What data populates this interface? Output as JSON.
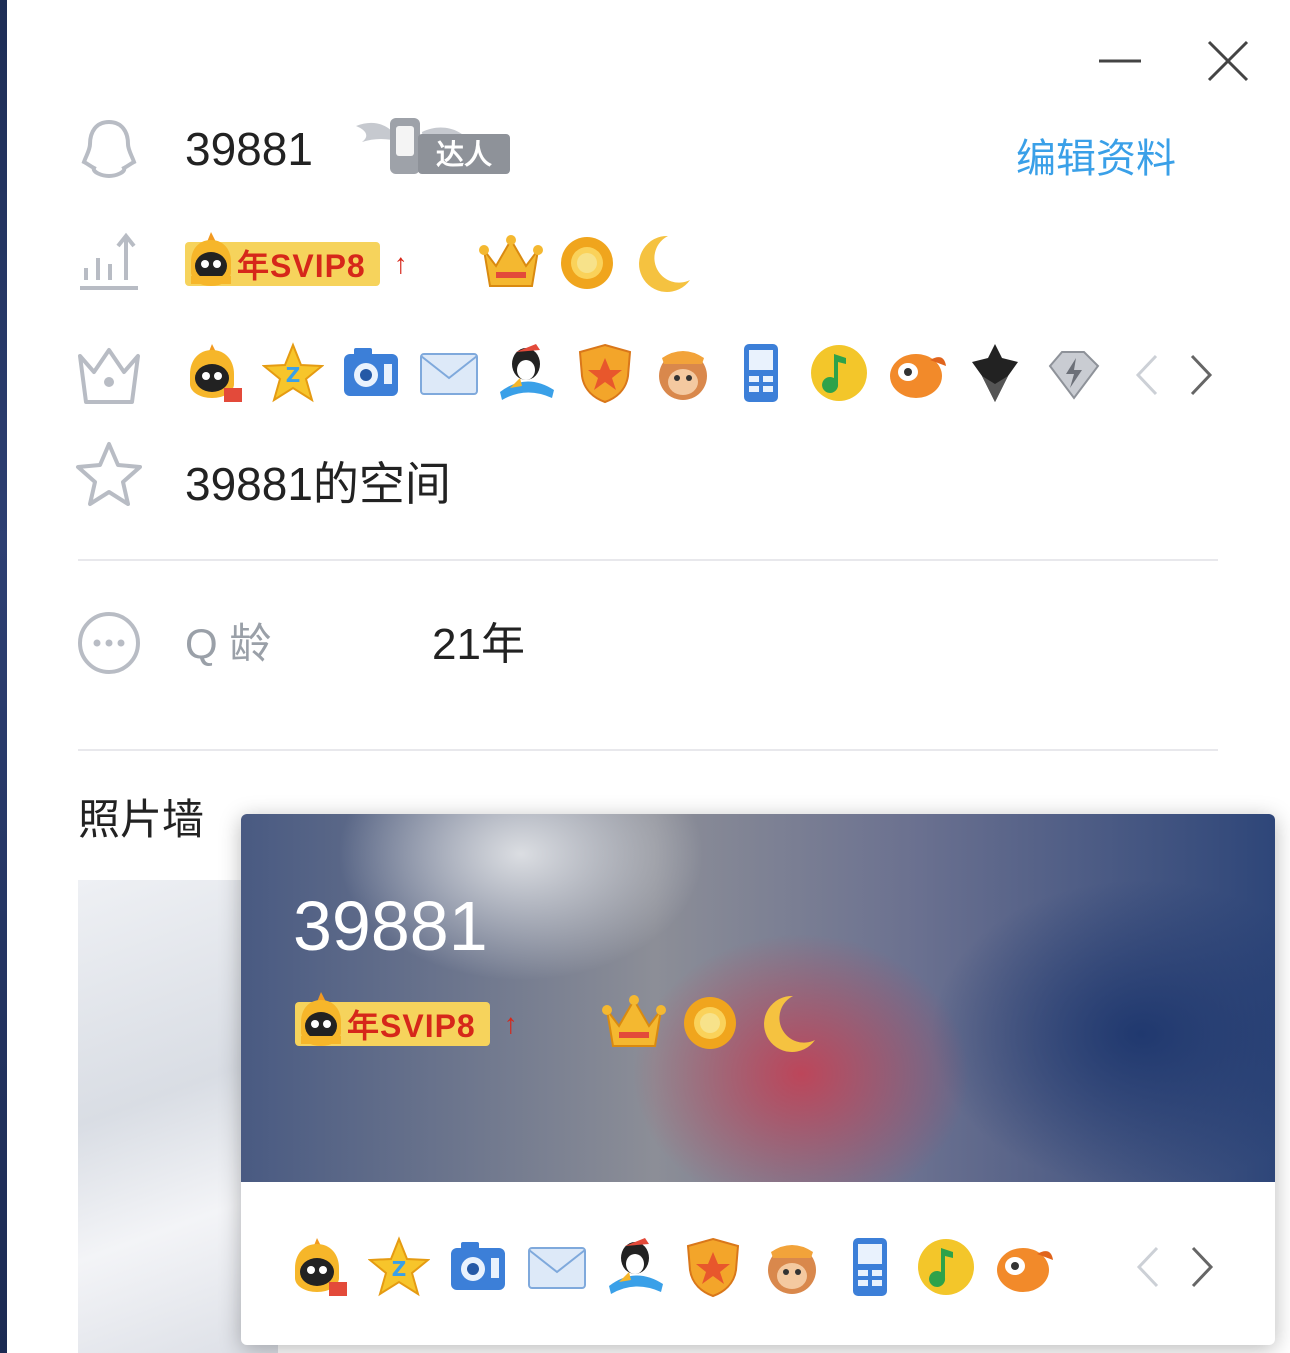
{
  "window": {
    "minimize_label": "minimize",
    "close_label": "close"
  },
  "profile": {
    "qq_number": "39881",
    "edit_label": "编辑资料",
    "vip_badge": "年SVIP8",
    "space_label": "39881的空间",
    "qage_label": "Q 龄",
    "qage_value": "21年"
  },
  "photo_wall": {
    "title": "照片墙"
  },
  "card": {
    "name": "39881",
    "vip_badge": "年SVIP8"
  },
  "icons": {
    "rows": [
      "qq-penguin-outline-icon",
      "level-chart-icon",
      "crown-outline-icon",
      "star-outline-icon",
      "more-circle-icon"
    ],
    "levels": [
      "crown-icon",
      "sun-icon",
      "moon-icon"
    ],
    "services": [
      "vip-penguin-icon",
      "qzone-star-icon",
      "camera-icon",
      "mail-icon",
      "qq-penguin-ski-icon",
      "shield-icon",
      "monkey-icon",
      "phone-icon",
      "music-icon",
      "fish-icon",
      "diamond-dark-icon",
      "diamond-silver-icon"
    ]
  },
  "colors": {
    "accent": "#3aa0e8",
    "vip_pill": "#f6d35c",
    "vip_text": "#d6271a"
  }
}
